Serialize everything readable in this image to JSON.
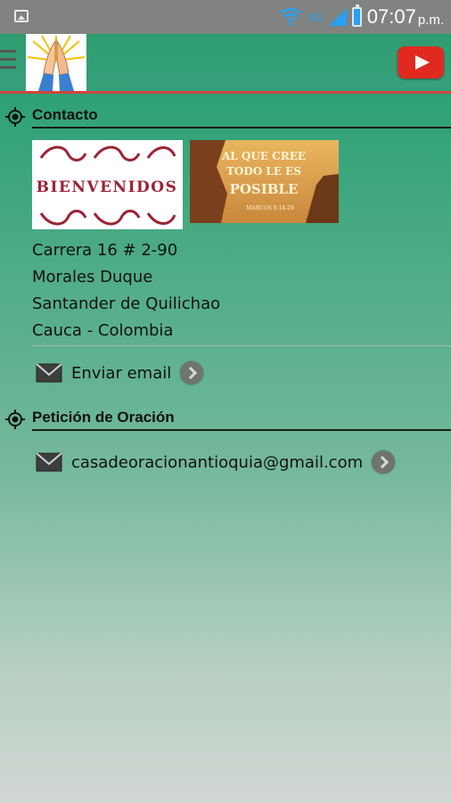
{
  "status_bar": {
    "network": "3G",
    "time": "07:07",
    "ampm": "p.m."
  },
  "app_bar": {
    "logo": "praying-hands",
    "accent_line_color": "#d0463f",
    "youtube_color": "#e02a20"
  },
  "contact": {
    "title": "Contacto",
    "images": [
      {
        "name": "bienvenidos-banner",
        "text": "BIENVENIDOS"
      },
      {
        "name": "verse-image",
        "line1": "AL QUE CREE",
        "line2": "TODO LE ES",
        "line3": "POSIBLE",
        "ref": "MARCOS 9.14-29"
      }
    ],
    "address": [
      "Carrera 16 # 2-90",
      "Morales Duque",
      "Santander de Quilichao",
      "Cauca - Colombia"
    ],
    "email_action": "Enviar email"
  },
  "prayer": {
    "title": "Petición de Oración",
    "email": "casadeoracionantioquia@gmail.com"
  }
}
